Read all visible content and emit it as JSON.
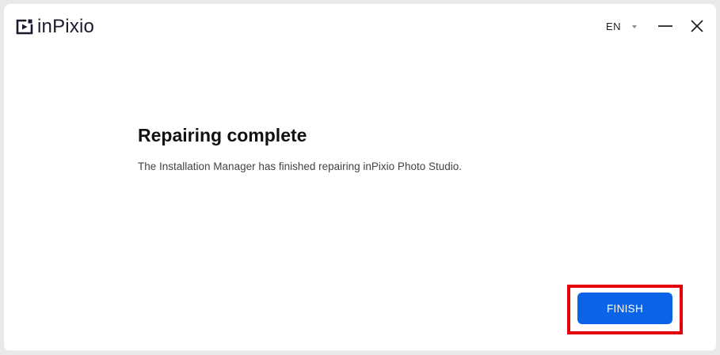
{
  "app": {
    "logo_text": "inPixio",
    "logo_icon": "play-frame-logo-icon"
  },
  "header": {
    "language": "EN",
    "language_icon": "caret-down-icon",
    "minimize_icon": "minimize-icon",
    "close_icon": "close-icon"
  },
  "main": {
    "title": "Repairing complete",
    "message": "The Installation Manager has finished repairing inPixio Photo Studio."
  },
  "footer": {
    "finish_label": "FINISH"
  },
  "colors": {
    "accent": "#0b64e8",
    "highlight": "#e3000b"
  }
}
